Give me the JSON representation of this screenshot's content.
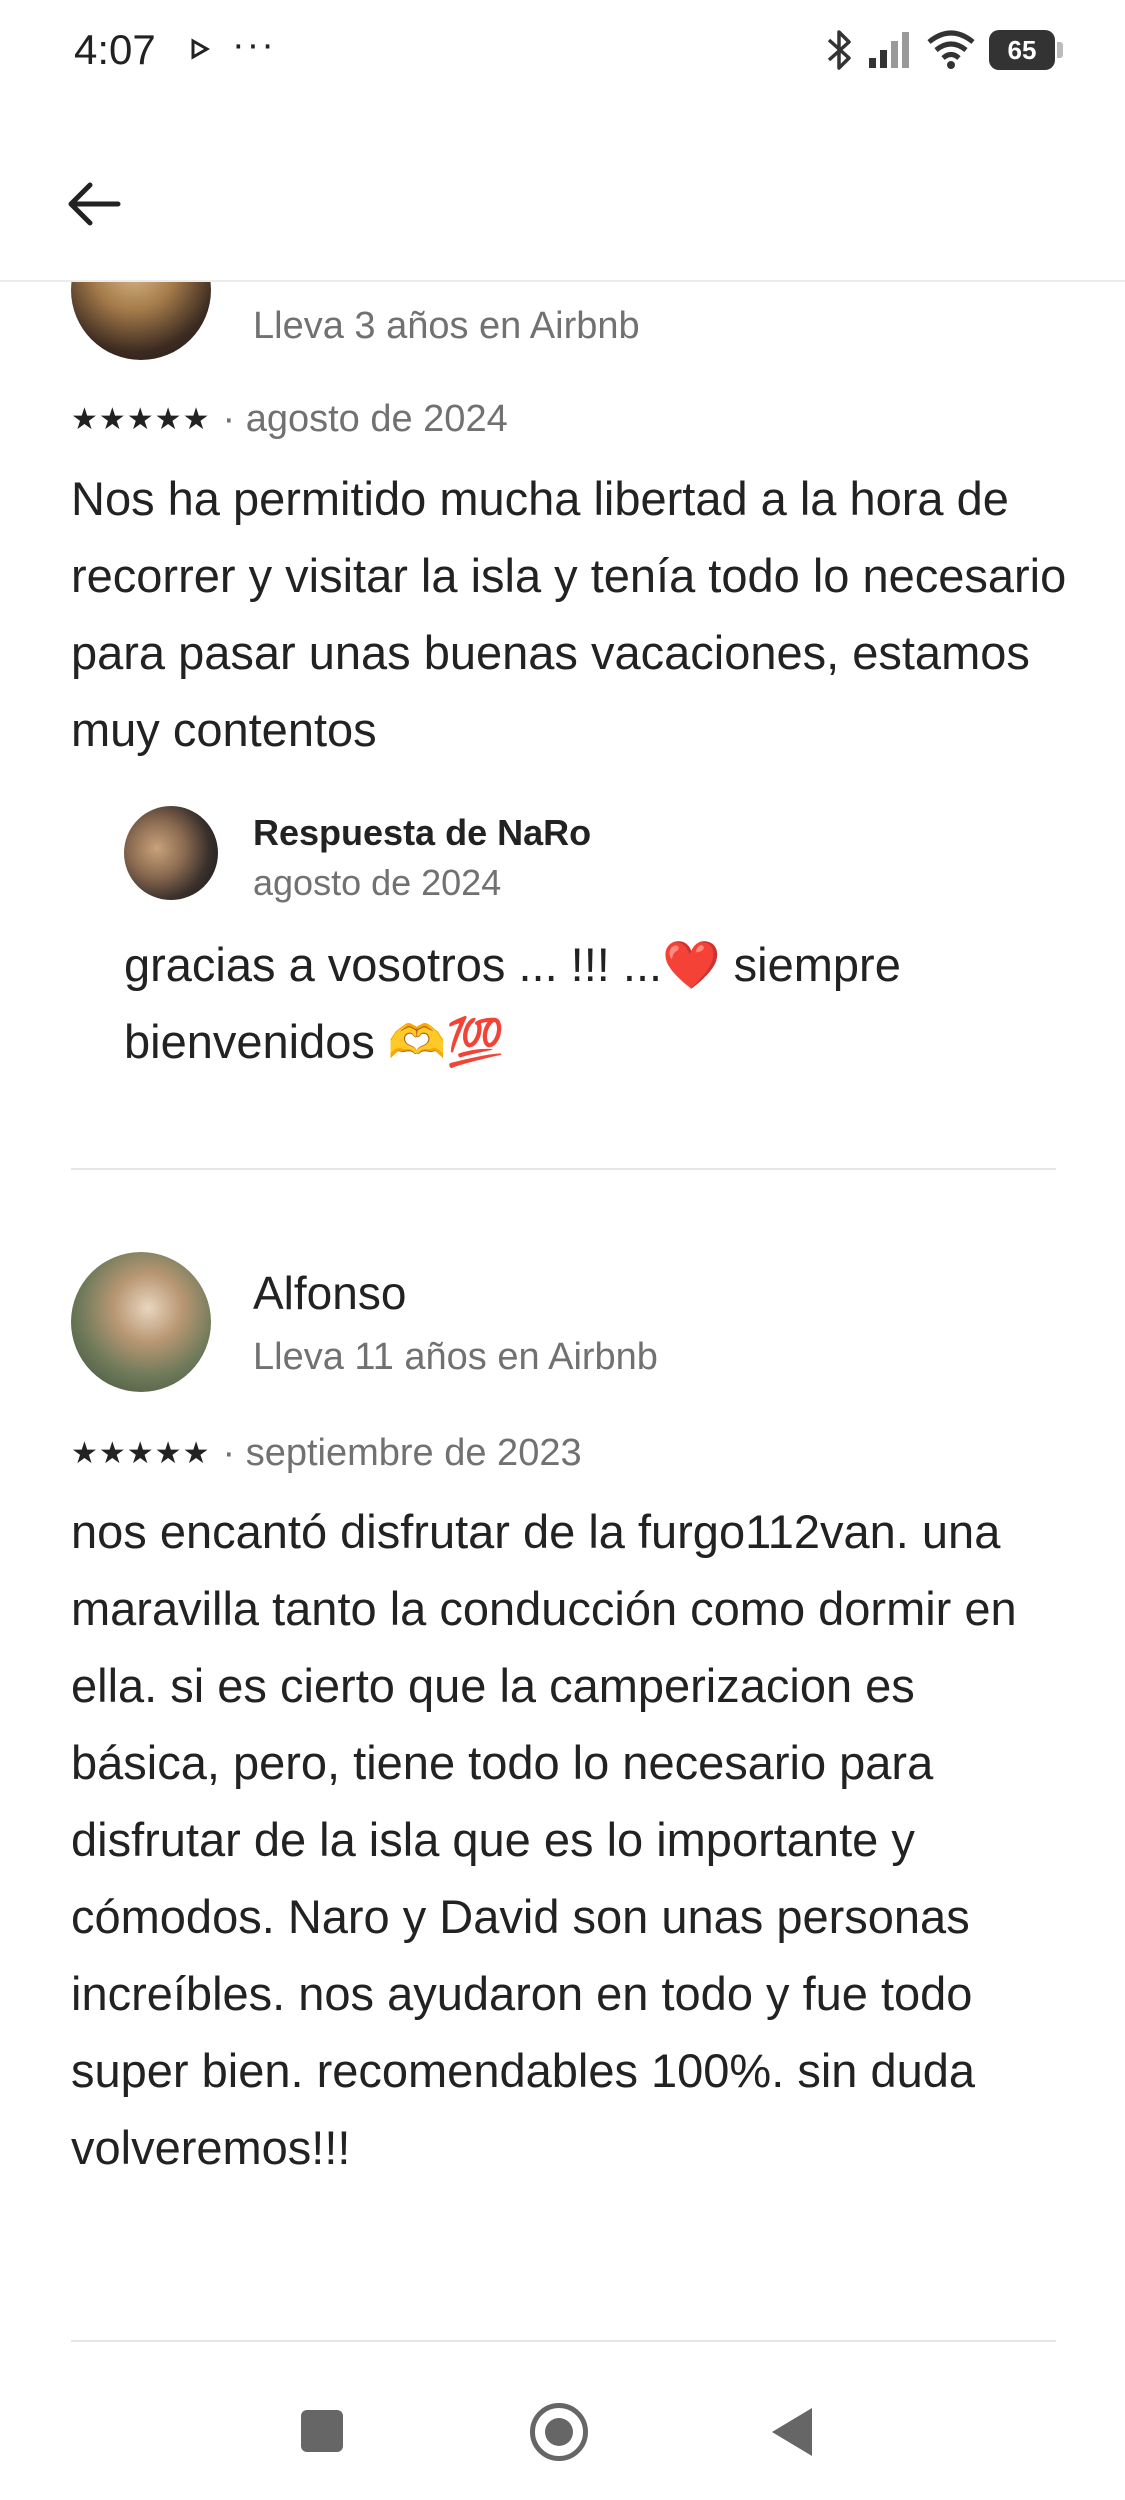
{
  "status_bar": {
    "time": "4:07",
    "dots": "···",
    "battery": "65",
    "icons": [
      "play-icon",
      "bluetooth-icon",
      "signal-icon",
      "wifi-icon",
      "battery-icon"
    ]
  },
  "header": {
    "back_icon": "arrow-left-icon"
  },
  "reviews": [
    {
      "tenure": "Lleva 3 años en Airbnb",
      "stars": "★★★★★",
      "date": "· agosto de 2024",
      "text": "Nos ha permitido mucha libertad a la hora de recorrer y visitar la isla y tenía todo lo necesario para pasar unas buenas vacaciones, estamos muy contentos",
      "response": {
        "title": "Respuesta de NaRo",
        "date": "agosto de 2024",
        "text": "gracias a vosotros ... !!! ...❤️ siempre bienvenidos 🫶💯"
      }
    },
    {
      "name": "Alfonso",
      "tenure": "Lleva 11 años en Airbnb",
      "stars": "★★★★★",
      "date": "· septiembre de 2023",
      "text": "nos encantó disfrutar de la furgo112van. una maravilla tanto la conducción como dormir en ella. si es cierto que la camperizacion es básica, pero, tiene todo lo necesario para disfrutar de la isla que es lo importante y cómodos. Naro y David son unas personas increíbles. nos ayudaron en todo y fue todo super bien. recomendables 100%. sin duda volveremos!!!"
    }
  ],
  "nav_bar": {
    "icons": [
      "recents-square-icon",
      "home-circle-icon",
      "back-triangle-icon"
    ]
  }
}
